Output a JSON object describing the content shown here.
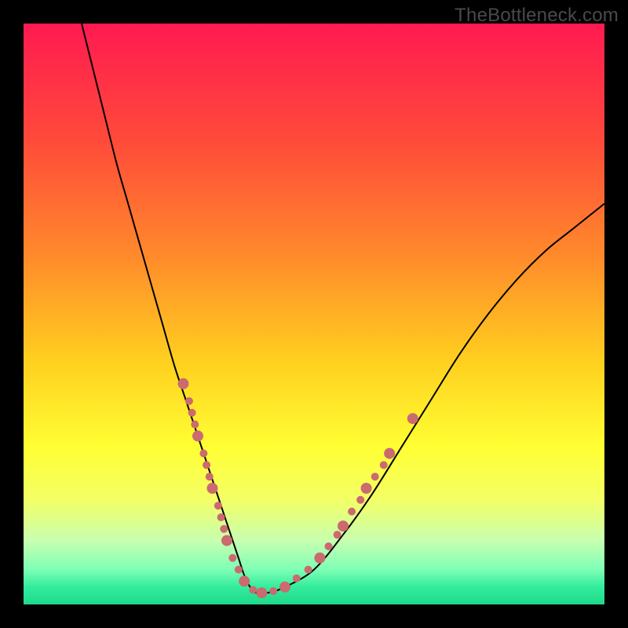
{
  "watermark": "TheBottleneck.com",
  "chart_data": {
    "type": "line",
    "title": "",
    "xlabel": "",
    "ylabel": "",
    "xlim": [
      0,
      100
    ],
    "ylim": [
      0,
      100
    ],
    "background_gradient_stops": [
      {
        "offset": 0.0,
        "color": "#ff1a51"
      },
      {
        "offset": 0.2,
        "color": "#ff4a3a"
      },
      {
        "offset": 0.4,
        "color": "#ff8a2b"
      },
      {
        "offset": 0.58,
        "color": "#ffcf1f"
      },
      {
        "offset": 0.73,
        "color": "#ffff33"
      },
      {
        "offset": 0.82,
        "color": "#f3ff66"
      },
      {
        "offset": 0.89,
        "color": "#c8ffb0"
      },
      {
        "offset": 0.94,
        "color": "#7dffb5"
      },
      {
        "offset": 0.97,
        "color": "#33ec9d"
      },
      {
        "offset": 1.0,
        "color": "#1fd98a"
      }
    ],
    "series": [
      {
        "name": "bottleneck-curve",
        "x": [
          10,
          12,
          14,
          16,
          18,
          20,
          22,
          24,
          26,
          28,
          30,
          31,
          32,
          33,
          34,
          35,
          36,
          37,
          38,
          39,
          40,
          42,
          45,
          50,
          55,
          60,
          65,
          70,
          75,
          80,
          85,
          90,
          95,
          100
        ],
        "y": [
          100,
          92,
          84,
          76,
          69,
          62,
          55,
          48,
          41,
          35,
          29,
          26,
          23,
          20,
          17,
          14,
          11,
          8,
          5,
          3,
          2,
          2,
          3,
          6,
          12,
          19,
          27,
          35,
          43,
          50,
          56,
          61,
          65,
          69
        ]
      }
    ],
    "markers": {
      "name": "highlight-dots",
      "color": "#cb6a6f",
      "radius_major": 7,
      "radius_minor": 5,
      "points": [
        {
          "x": 27.5,
          "y": 38,
          "r": 7
        },
        {
          "x": 28.5,
          "y": 35,
          "r": 5
        },
        {
          "x": 29.0,
          "y": 33,
          "r": 5
        },
        {
          "x": 29.5,
          "y": 31,
          "r": 5
        },
        {
          "x": 30.0,
          "y": 29,
          "r": 7
        },
        {
          "x": 31.0,
          "y": 26,
          "r": 5
        },
        {
          "x": 31.5,
          "y": 24,
          "r": 5
        },
        {
          "x": 32.0,
          "y": 22,
          "r": 5
        },
        {
          "x": 32.5,
          "y": 20,
          "r": 7
        },
        {
          "x": 33.5,
          "y": 17,
          "r": 5
        },
        {
          "x": 34.0,
          "y": 15,
          "r": 5
        },
        {
          "x": 34.5,
          "y": 13,
          "r": 5
        },
        {
          "x": 35.0,
          "y": 11,
          "r": 7
        },
        {
          "x": 36.0,
          "y": 8,
          "r": 5
        },
        {
          "x": 37.0,
          "y": 6,
          "r": 5
        },
        {
          "x": 38.0,
          "y": 4,
          "r": 7
        },
        {
          "x": 39.5,
          "y": 2.5,
          "r": 5
        },
        {
          "x": 41.0,
          "y": 2,
          "r": 7
        },
        {
          "x": 43.0,
          "y": 2.3,
          "r": 5
        },
        {
          "x": 45.0,
          "y": 3,
          "r": 7
        },
        {
          "x": 47.0,
          "y": 4.5,
          "r": 5
        },
        {
          "x": 49.0,
          "y": 6,
          "r": 5
        },
        {
          "x": 51.0,
          "y": 8,
          "r": 7
        },
        {
          "x": 52.5,
          "y": 10,
          "r": 5
        },
        {
          "x": 54.0,
          "y": 12,
          "r": 5
        },
        {
          "x": 55.0,
          "y": 13.5,
          "r": 7
        },
        {
          "x": 56.5,
          "y": 16,
          "r": 5
        },
        {
          "x": 58.0,
          "y": 18,
          "r": 5
        },
        {
          "x": 59.0,
          "y": 20,
          "r": 7
        },
        {
          "x": 60.5,
          "y": 22,
          "r": 5
        },
        {
          "x": 62.0,
          "y": 24,
          "r": 5
        },
        {
          "x": 63.0,
          "y": 26,
          "r": 7
        },
        {
          "x": 67.0,
          "y": 32,
          "r": 7
        }
      ]
    }
  }
}
